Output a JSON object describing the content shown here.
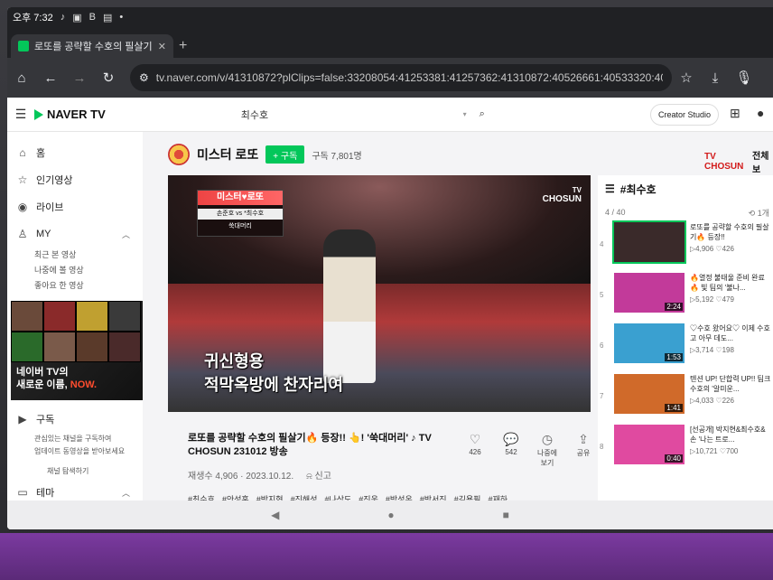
{
  "status_bar": {
    "time": "오후 7:32",
    "icons": [
      "♪",
      "▣",
      "B",
      "▤",
      "•"
    ]
  },
  "browser": {
    "tab_title": "로또를 공략할 수호의 필살기🔥",
    "url": "tv.naver.com/v/41310872?plClips=false:33208054:41253381:41257362:41310872:40526661:40533320:4052846"
  },
  "header": {
    "logo": "NAVER TV",
    "search_value": "최수호",
    "creator_studio": "Creator Studio"
  },
  "sidebar": {
    "items": [
      {
        "label": "홈",
        "icon": "home-icon",
        "glyph": "⌂"
      },
      {
        "label": "인기영상",
        "icon": "star-icon",
        "glyph": "☆"
      },
      {
        "label": "라이브",
        "icon": "live-icon",
        "glyph": "◉"
      },
      {
        "label": "MY",
        "icon": "user-icon",
        "glyph": "♙"
      }
    ],
    "my_subitems": [
      "최근 본 영상",
      "나중에 볼 영상",
      "좋아요 한 영상"
    ],
    "banner": {
      "line1": "네이버 TV의",
      "line2": "새로운 이름,",
      "now": "NOW."
    },
    "subscribe_label": "구독",
    "subscribe_desc1": "관심있는 채널을 구독하여",
    "subscribe_desc2": "업데이트 동영상을 받아보세요",
    "explore_channels": "채널 탐색하기",
    "theme_label": "테마"
  },
  "channel": {
    "name": "미스터 로또",
    "subscribe_button": "+ 구독",
    "subscriber_count": "구독 7,801명",
    "network": "TV CHOSUN",
    "network_extra": "전체보"
  },
  "video": {
    "scoreboard_title": "미스터♥로또",
    "scoreboard_vs": "손준호   vs   *최수호",
    "scoreboard_song": "쑥대머리",
    "watermark_line1": "TV",
    "watermark_line2": "CHOSUN",
    "lyric_line1": "귀신형용",
    "lyric_line2": "적막옥방에 찬자리여",
    "title": "로또를 공략할 수호의 필살기🔥 등장!! 👆! '쑥대머리' ♪ TV CHOSUN 231012 방송",
    "views": "재생수 4,906 · 2023.10.12.",
    "report": "신고",
    "tags": [
      "#최수호",
      "#안성훈",
      "#박지현",
      "#진해성",
      "#나상도",
      "#진욱",
      "#박성온",
      "#박서진",
      "#김용필",
      "#재하"
    ]
  },
  "actions": [
    {
      "glyph": "♡",
      "label": "426",
      "name": "like-button"
    },
    {
      "glyph": "💬",
      "label": "542",
      "name": "comment-button"
    },
    {
      "glyph": "◷",
      "label": "나중에 보기",
      "name": "watch-later-button"
    },
    {
      "glyph": "⇪",
      "label": "공유",
      "name": "share-button"
    }
  ],
  "playlist": {
    "title": "#최수호",
    "position": "4 / 40",
    "repeat": "1개",
    "items": [
      {
        "num": "4",
        "title": "로또를 공략할 수호의 필살기🔥 등장!!",
        "views": "▷4,906",
        "likes": "♡426",
        "duration": "",
        "color": "#3a2a2a",
        "active": true
      },
      {
        "num": "5",
        "title": "🔥열정 불태울 준비 완료🔥 빛 팀의 '불나...",
        "views": "▷5,192",
        "likes": "♡479",
        "duration": "2:24",
        "color": "#c23a9a",
        "active": false
      },
      {
        "num": "6",
        "title": "♡수호 왔어요♡ 이제 수호 고 아무 데도...",
        "views": "▷3,714",
        "likes": "♡198",
        "duration": "1:53",
        "color": "#3aa0d0",
        "active": false
      },
      {
        "num": "7",
        "title": "텐션 UP! 단합력 UP!! 팀크 수호의 '알미운...",
        "views": "▷4,033",
        "likes": "♡226",
        "duration": "1:41",
        "color": "#d06a2a",
        "active": false
      },
      {
        "num": "8",
        "title": "[선공개] 박지현&최수호&손 '나는 트로...",
        "views": "▷10,721",
        "likes": "♡700",
        "duration": "0:40",
        "color": "#e04aa0",
        "active": false
      }
    ]
  },
  "android_nav": {
    "back": "◀",
    "home": "●",
    "recents": "■"
  }
}
